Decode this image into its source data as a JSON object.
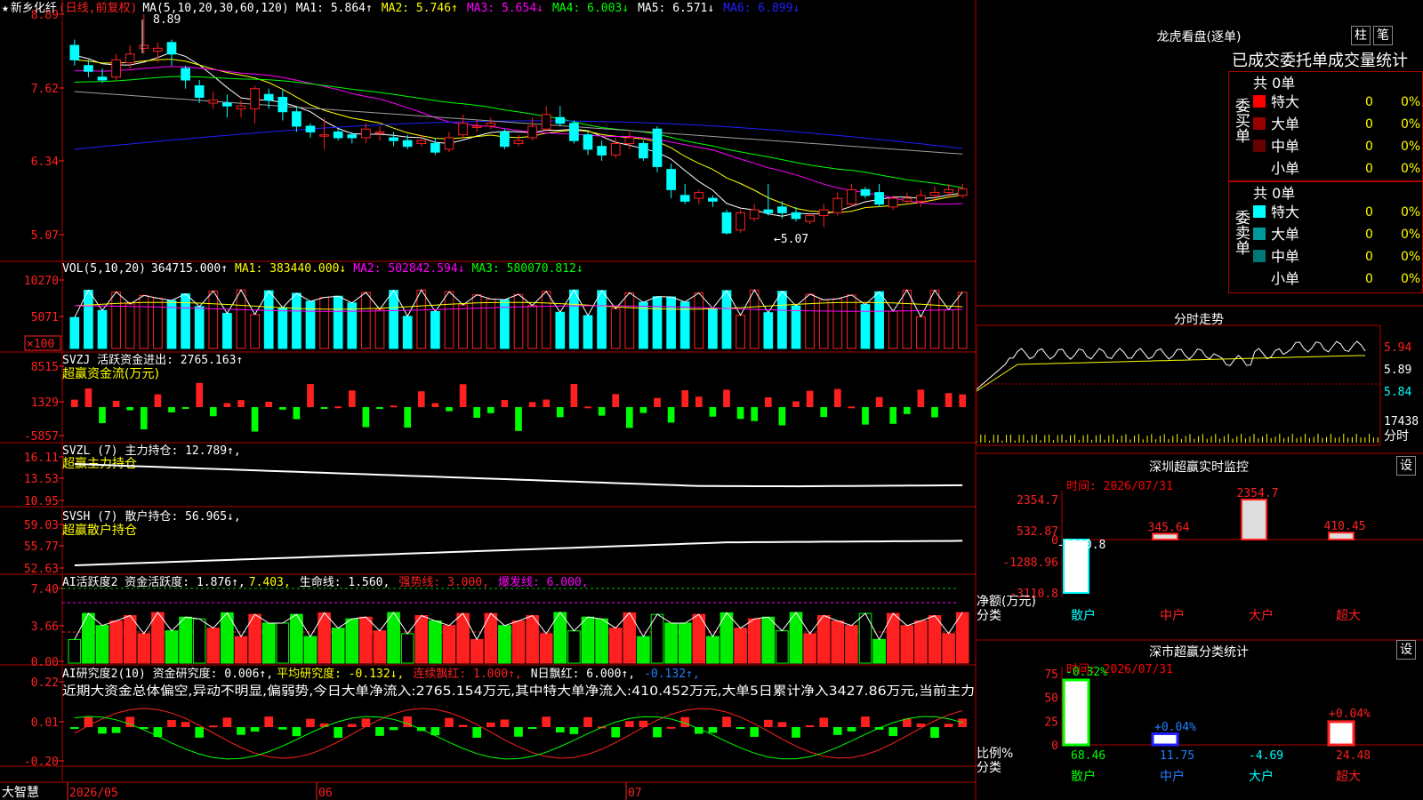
{
  "stock": {
    "star": "★",
    "name": "新乡化纤",
    "period": "(日线,前复权)",
    "ma_head": "MA(5,10,20,30,60,120)",
    "ma1": "MA1: 5.864↑",
    "ma2": "MA2: 5.746↑",
    "ma3": "MA3: 5.654↓",
    "ma4": "MA4: 6.003↓",
    "ma5": "MA5: 6.571↓",
    "ma6": "MA6: 6.899↓"
  },
  "main_axis": {
    "y1": "8.89",
    "y2": "7.62",
    "y3": "6.34",
    "y4": "5.07"
  },
  "annot": {
    "high": "8.89",
    "low": "←5.07"
  },
  "vol": {
    "head": "VOL(5,10,20)",
    "val": "364715.000↑",
    "ma1": "MA1: 383440.000↓",
    "ma2": "MA2: 502842.594↓",
    "ma3": "MA3: 580070.812↓",
    "y1": "10270",
    "y2": "5071",
    "unit": "×100"
  },
  "svzj": {
    "head": "SVZJ  活跃资金进出: 2765.163↑",
    "sub": "超赢资金流(万元)",
    "y1": "8515",
    "y2": "1329",
    "y3": "-5857"
  },
  "svzl": {
    "head": "SVZL (7) 主力持仓: 12.789↑,",
    "sub": "超赢主力持仓",
    "y1": "16.11",
    "y2": "13.53",
    "y3": "10.95"
  },
  "svsh": {
    "head": "SVSH (7) 散户持仓: 56.965↓,",
    "sub": "超赢散户持仓",
    "y1": "59.03",
    "y2": "55.77",
    "y3": "52.63"
  },
  "ai1": {
    "head": "AI活跃度2 资金活跃度: 1.876↑,",
    "v2": "7.403,",
    "life": "生命线: 1.560,",
    "strong": "强势线: 3.000,",
    "burst": "爆发线: 6.000,",
    "y1": "7.40",
    "y2": "3.66",
    "y3": "0.00"
  },
  "ai2": {
    "head": "AI研究度2(10) 资金研究度: 0.006↑,",
    "avg": "平均研究度: -0.132↓,",
    "cont": "连续飘红: 1.000↑,",
    "nday": "N日飘红: 6.000↑,",
    "last": "-0.132↑,",
    "text": "近期大资金总体偏空,异动不明显,偏弱势,今日大单净流入:2765.154万元,其中特大单净流入:410.452万元,大单5日累计净入3427.86万元,当前主力",
    "y1": "0.22",
    "y2": "0.01",
    "y3": "-0.20"
  },
  "xaxis": {
    "brand": "大智慧",
    "d1": "2026/05",
    "d2": "06",
    "d3": "07"
  },
  "dragon": {
    "title": "龙虎看盘(逐单)",
    "btn1": "柱",
    "btn2": "笔",
    "tabs": "已成交委托单成交量统计",
    "buy_label": "委买单",
    "sell_label": "委卖单",
    "buy_total": "共 0单",
    "sell_total": "共 0单",
    "buy_rows": [
      {
        "name": "特大",
        "color": "#ff0000",
        "n": "0",
        "p": "0%"
      },
      {
        "name": "大单",
        "color": "#990000",
        "n": "0",
        "p": "0%"
      },
      {
        "name": "中单",
        "color": "#660000",
        "n": "0",
        "p": "0%"
      },
      {
        "name": "小单",
        "color": "#000000",
        "n": "0",
        "p": "0%"
      }
    ],
    "sell_rows": [
      {
        "name": "特大",
        "color": "#00ffff",
        "n": "0",
        "p": "0%"
      },
      {
        "name": "大单",
        "color": "#009999",
        "n": "0",
        "p": "0%"
      },
      {
        "name": "中单",
        "color": "#007777",
        "n": "0",
        "p": "0%"
      },
      {
        "name": "小单",
        "color": "#000000",
        "n": "0",
        "p": "0%"
      }
    ]
  },
  "intraday": {
    "title": "分时走势",
    "y1": "5.94",
    "y2": "5.89",
    "y3": "5.84",
    "vol": "17438",
    "label": "分时"
  },
  "monitor": {
    "title": "深圳超赢实时监控",
    "btn": "设",
    "time": "时间: 2026/07/31",
    "y1": "2354.7",
    "y2": "532.87",
    "y3": "0",
    "y4": "-1288.96",
    "y5": "-3110.8",
    "net": "净额(万元)",
    "cls": "分类",
    "cats": [
      "散户",
      "中户",
      "大户",
      "超大"
    ],
    "vals": [
      "-3110.8",
      "345.64",
      "2354.7",
      "410.45"
    ]
  },
  "classstat": {
    "title": "深市超赢分类统计",
    "btn": "设",
    "time": "时间: 2026/07/31",
    "y1": "75",
    "y2": "50",
    "y3": "25",
    "y4": "0",
    "pct": [
      "-0.32%",
      "+0.04%",
      "+0.04%"
    ],
    "ratio": "比例%",
    "cls": "分类",
    "cats": [
      "散户",
      "中户",
      "大户",
      "超大"
    ],
    "vals": [
      "68.46",
      "11.75",
      "-4.69",
      "24.48"
    ]
  },
  "chart_data": {
    "type": "candlestick",
    "title": "新乡化纤(日线,前复权)",
    "x_labels": [
      "2026/05",
      "06",
      "07"
    ],
    "ylim": [
      5.07,
      8.89
    ],
    "annotations": [
      "8.89",
      "←5.07"
    ],
    "candles": [
      [
        8.35,
        8.1,
        8.45,
        8.0
      ],
      [
        8.0,
        7.9,
        8.1,
        7.8
      ],
      [
        7.8,
        7.75,
        7.95,
        7.7
      ],
      [
        7.8,
        8.1,
        8.2,
        7.75
      ],
      [
        8.05,
        8.2,
        8.35,
        7.95
      ],
      [
        8.3,
        8.35,
        8.89,
        8.2
      ],
      [
        8.25,
        8.3,
        8.4,
        8.05
      ],
      [
        8.4,
        8.2,
        8.45,
        8.0
      ],
      [
        7.95,
        7.75,
        8.0,
        7.6
      ],
      [
        7.65,
        7.45,
        7.75,
        7.35
      ],
      [
        7.35,
        7.4,
        7.55,
        7.25
      ],
      [
        7.35,
        7.3,
        7.5,
        7.1
      ],
      [
        7.25,
        7.3,
        7.4,
        7.1
      ],
      [
        7.25,
        7.6,
        7.65,
        7.0
      ],
      [
        7.5,
        7.4,
        7.6,
        7.25
      ],
      [
        7.45,
        7.2,
        7.6,
        7.05
      ],
      [
        7.2,
        6.95,
        7.3,
        6.85
      ],
      [
        6.95,
        6.85,
        7.0,
        6.75
      ],
      [
        6.8,
        6.8,
        7.1,
        6.55
      ],
      [
        6.85,
        6.75,
        6.9,
        6.7
      ],
      [
        6.8,
        6.75,
        6.85,
        6.65
      ],
      [
        6.75,
        6.9,
        7.0,
        6.65
      ],
      [
        6.85,
        6.85,
        6.95,
        6.7
      ],
      [
        6.75,
        6.7,
        6.85,
        6.6
      ],
      [
        6.7,
        6.6,
        6.8,
        6.55
      ],
      [
        6.65,
        6.7,
        6.8,
        6.6
      ],
      [
        6.65,
        6.5,
        6.75,
        6.45
      ],
      [
        6.55,
        6.75,
        6.85,
        6.5
      ],
      [
        6.8,
        7.0,
        7.15,
        6.75
      ],
      [
        6.95,
        6.95,
        7.05,
        6.85
      ],
      [
        6.95,
        7.0,
        7.1,
        6.9
      ],
      [
        6.85,
        6.6,
        6.9,
        6.55
      ],
      [
        6.65,
        6.7,
        6.8,
        6.6
      ],
      [
        6.75,
        6.95,
        7.1,
        6.7
      ],
      [
        6.9,
        7.15,
        7.3,
        6.85
      ],
      [
        7.1,
        7.0,
        7.3,
        6.95
      ],
      [
        7.0,
        6.7,
        7.05,
        6.65
      ],
      [
        6.8,
        6.55,
        6.85,
        6.45
      ],
      [
        6.6,
        6.45,
        6.7,
        6.35
      ],
      [
        6.45,
        6.65,
        6.75,
        6.4
      ],
      [
        6.65,
        6.75,
        6.85,
        6.55
      ],
      [
        6.65,
        6.4,
        6.7,
        6.35
      ],
      [
        6.9,
        6.25,
        6.95,
        6.15
      ],
      [
        6.2,
        5.85,
        6.3,
        5.7
      ],
      [
        5.75,
        5.65,
        5.95,
        5.6
      ],
      [
        5.7,
        5.8,
        5.85,
        5.6
      ],
      [
        5.7,
        5.65,
        5.75,
        5.55
      ],
      [
        5.45,
        5.1,
        5.5,
        5.07
      ],
      [
        5.15,
        5.45,
        5.5,
        5.1
      ],
      [
        5.35,
        5.5,
        5.6,
        5.3
      ],
      [
        5.5,
        5.45,
        5.95,
        5.4
      ],
      [
        5.55,
        5.45,
        5.65,
        5.35
      ],
      [
        5.45,
        5.35,
        5.55,
        5.3
      ],
      [
        5.3,
        5.4,
        5.45,
        5.25
      ],
      [
        5.4,
        5.5,
        5.6,
        5.2
      ],
      [
        5.45,
        5.7,
        5.8,
        5.4
      ],
      [
        5.6,
        5.85,
        5.95,
        5.55
      ],
      [
        5.85,
        5.75,
        5.9,
        5.7
      ],
      [
        5.8,
        5.6,
        5.95,
        5.55
      ],
      [
        5.55,
        5.7,
        5.75,
        5.5
      ],
      [
        5.65,
        5.7,
        5.8,
        5.6
      ],
      [
        5.65,
        5.75,
        5.85,
        5.55
      ],
      [
        5.75,
        5.8,
        5.9,
        5.65
      ],
      [
        5.8,
        5.85,
        5.95,
        5.7
      ],
      [
        5.75,
        5.864,
        5.95,
        5.7
      ]
    ]
  }
}
